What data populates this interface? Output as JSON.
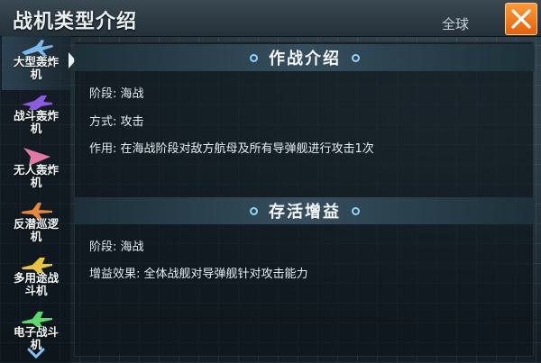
{
  "header": {
    "title": "战机类型介绍",
    "corner_text": "全球",
    "close_icon": "close-x-icon",
    "accent_color": "#f07a1e"
  },
  "sidebar": {
    "items": [
      {
        "label_line1": "大型轰炸",
        "label_line2": "机",
        "icon": "bomber-jet-icon",
        "color": "#7fb8e8",
        "active": true
      },
      {
        "label_line1": "战斗轰炸",
        "label_line2": "机",
        "icon": "fighter-bomber-jet-icon",
        "color": "#8c5be0",
        "active": false
      },
      {
        "label_line1": "无人轰炸",
        "label_line2": "机",
        "icon": "drone-bomber-icon",
        "color": "#e07aa4",
        "active": false
      },
      {
        "label_line1": "反潜巡逻",
        "label_line2": "机",
        "icon": "patrol-plane-icon",
        "color": "#e68a3a",
        "active": false
      },
      {
        "label_line1": "多用途战",
        "label_line2": "斗机",
        "icon": "multirole-fighter-icon",
        "color": "#e8c43a",
        "active": false
      },
      {
        "label_line1": "电子战斗",
        "label_line2": "机",
        "icon": "ew-fighter-icon",
        "color": "#5fd86a",
        "active": false
      }
    ],
    "scroll_icon": "chevron-down-icon"
  },
  "combat_intro": {
    "title": "作战介绍",
    "stage_label": "阶段:",
    "stage_value": "海战",
    "method_label": "方式:",
    "method_value": "攻击",
    "effect_label": "作用:",
    "effect_value": "在海战阶段对敌方航母及所有导弹舰进行攻击1次"
  },
  "survival_bonus": {
    "title": "存活增益",
    "stage_label": "阶段:",
    "stage_value": "海战",
    "effect_label": "增益效果:",
    "effect_value": "全体战舰对导弹舰针对攻击能力"
  }
}
